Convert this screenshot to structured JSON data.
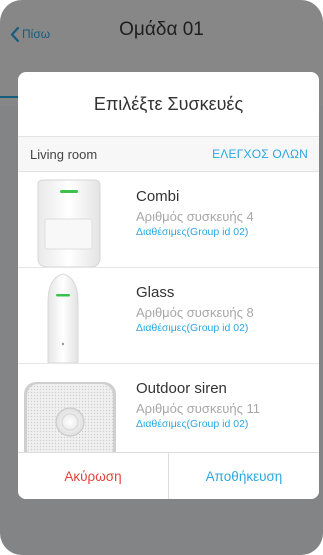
{
  "navbar": {
    "back_label": "Πίσω",
    "title": "Ομάδα 01"
  },
  "modal": {
    "title": "Επιλέξτε Συσκευές",
    "room": "Living room",
    "check_all": "ΕΛΕΓΧΟΣ ΟΛΩΝ",
    "devices": [
      {
        "name": "Combi",
        "number": "Αριθμός συσκευής 4",
        "status": "Διαθέσιμες(Group id 02)",
        "icon": "motion-detector-icon"
      },
      {
        "name": "Glass",
        "number": "Αριθμός συσκευής 8",
        "status": "Διαθέσιμες(Group id 02)",
        "icon": "glass-break-detector-icon"
      },
      {
        "name": "Outdoor siren",
        "number": "Αριθμός συσκευής 11",
        "status": "Διαθέσιμες(Group id 02)",
        "icon": "outdoor-siren-icon"
      }
    ],
    "cancel_label": "Ακύρωση",
    "save_label": "Αποθήκευση"
  },
  "colors": {
    "accent": "#2aa8e0",
    "cancel": "#e0443a",
    "led": "#3cc24a"
  }
}
